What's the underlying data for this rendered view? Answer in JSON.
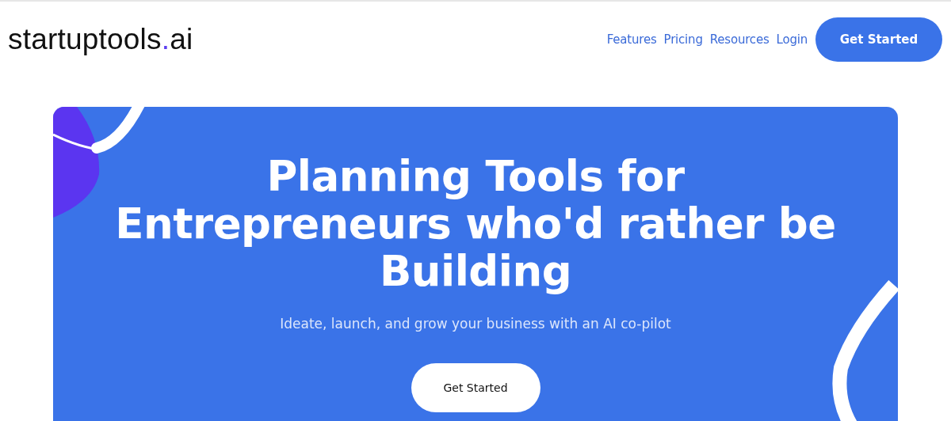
{
  "header": {
    "logo": {
      "name": "startuptools",
      "dot": ".",
      "tld": "ai"
    },
    "nav": [
      {
        "label": "Features"
      },
      {
        "label": "Pricing"
      },
      {
        "label": "Resources"
      },
      {
        "label": "Login"
      }
    ],
    "cta": "Get Started"
  },
  "hero": {
    "headline": "Planning Tools for Entrepreneurs who'd rather be Building",
    "subtitle": "Ideate, launch, and grow your business with an AI co-pilot",
    "cta": "Get Started"
  }
}
